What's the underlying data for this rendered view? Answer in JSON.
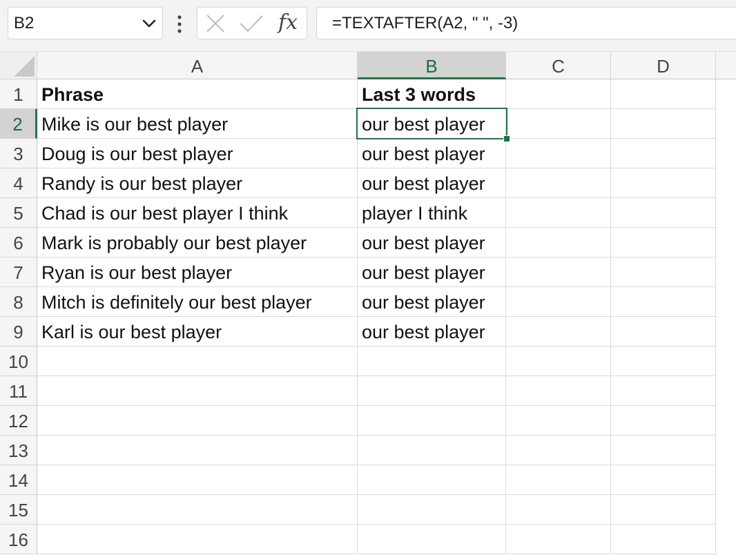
{
  "formula_bar": {
    "name_box": "B2",
    "formula": "=TEXTAFTER(A2, \" \", -3)",
    "fx_label": "fx"
  },
  "columns": [
    "A",
    "B",
    "C",
    "D"
  ],
  "rows": [
    "1",
    "2",
    "3",
    "4",
    "5",
    "6",
    "7",
    "8",
    "9",
    "10",
    "11",
    "12",
    "13",
    "14",
    "15",
    "16"
  ],
  "cells": {
    "header": {
      "a": "Phrase",
      "b": "Last 3 words"
    },
    "data": [
      {
        "a": "Mike is our best player",
        "b": "our best player"
      },
      {
        "a": "Doug is our best player",
        "b": "our best player"
      },
      {
        "a": "Randy is our best player",
        "b": "our best player"
      },
      {
        "a": "Chad is our best player I think",
        "b": "player I think"
      },
      {
        "a": "Mark is probably our best player",
        "b": "our best player"
      },
      {
        "a": "Ryan is our best player",
        "b": "our best player"
      },
      {
        "a": "Mitch is definitely our best player",
        "b": "our best player"
      },
      {
        "a": "Karl is our best player",
        "b": "our best player"
      }
    ]
  },
  "selection": {
    "active_cell": "B2",
    "column": "B",
    "row": "2"
  },
  "colors": {
    "accent": "#217346"
  }
}
